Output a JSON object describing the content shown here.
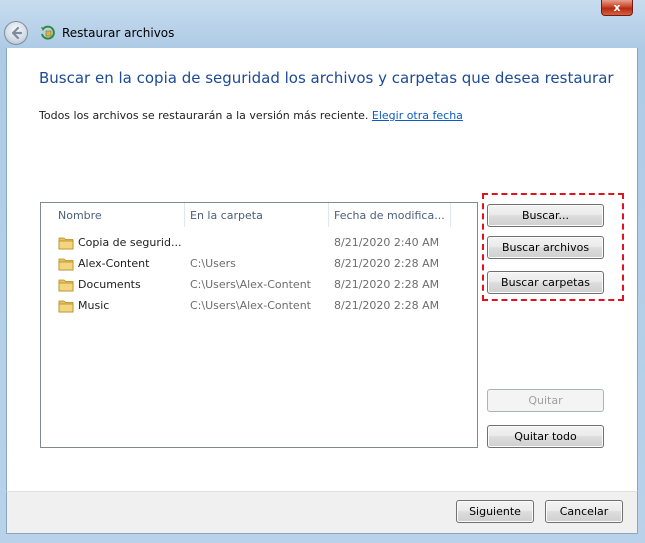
{
  "window": {
    "title": "Restaurar archivos",
    "close_label": "x"
  },
  "icons": {
    "back": "back-arrow-icon",
    "app": "restore-files-icon",
    "folder": "folder-icon"
  },
  "main": {
    "heading": "Buscar en la copia de seguridad los archivos y carpetas que desea restaurar",
    "subtext": "Todos los archivos se restaurarán a la versión más reciente.",
    "link_text": "Elegir otra fecha"
  },
  "list": {
    "columns": [
      "Nombre",
      "En la carpeta",
      "Fecha de modifica..."
    ],
    "rows": [
      {
        "name": "Copia de segurid...",
        "folder": "",
        "date": "8/21/2020 2:40 AM"
      },
      {
        "name": "Alex-Content",
        "folder": "C:\\Users",
        "date": "8/21/2020 2:28 AM"
      },
      {
        "name": "Documents",
        "folder": "C:\\Users\\Alex-Content",
        "date": "8/21/2020 2:28 AM"
      },
      {
        "name": "Music",
        "folder": "C:\\Users\\Alex-Content",
        "date": "8/21/2020 2:28 AM"
      }
    ]
  },
  "buttons": {
    "search": "Buscar...",
    "search_files": "Buscar archivos",
    "search_folders": "Buscar carpetas",
    "remove": "Quitar",
    "remove_all": "Quitar todo",
    "next": "Siguiente",
    "cancel": "Cancelar"
  },
  "colors": {
    "heading": "#1d4a97",
    "link": "#0b5dc4",
    "highlight": "#e0141e",
    "folder": "#e8c25a"
  }
}
